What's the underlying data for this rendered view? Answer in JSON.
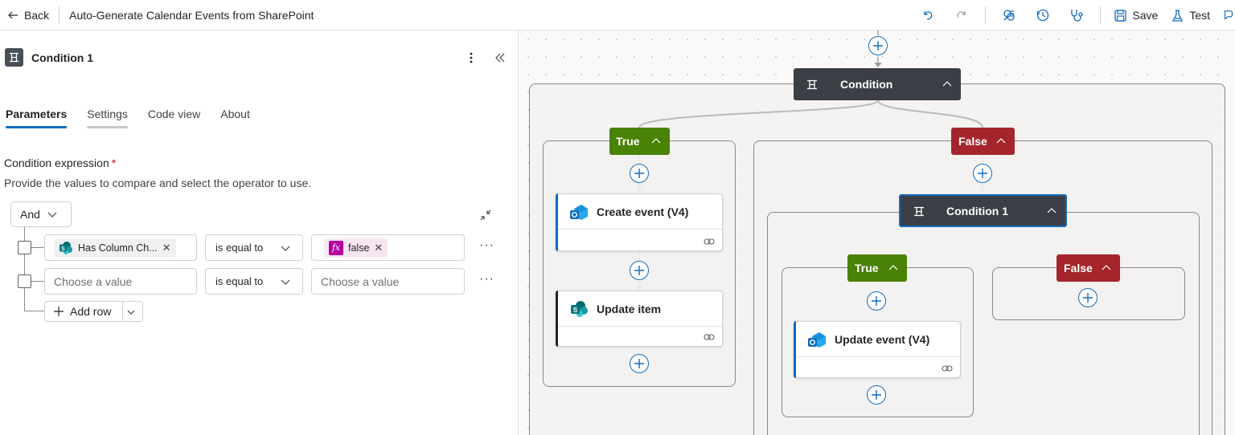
{
  "topbar": {
    "back_label": "Back",
    "title": "Auto-Generate Calendar Events from SharePoint",
    "save_label": "Save",
    "test_label": "Test"
  },
  "panel": {
    "title": "Condition 1",
    "tabs": [
      "Parameters",
      "Settings",
      "Code view",
      "About"
    ],
    "field_label": "Condition expression",
    "required_mark": "*",
    "hint": "Provide the values to compare and select the operator to use.",
    "group_operator": "And",
    "rows": [
      {
        "left_token": "Has Column Ch...",
        "operator": "is equal to",
        "right_token": "false"
      },
      {
        "left_placeholder": "Choose a value",
        "operator": "is equal to",
        "right_placeholder": "Choose a value"
      }
    ],
    "add_row_label": "Add row",
    "more": "···"
  },
  "canvas": {
    "condition": "Condition",
    "true_label": "True",
    "false_label": "False",
    "create_event": "Create event (V4)",
    "update_item": "Update item",
    "condition1": "Condition 1",
    "inner_true": "True",
    "inner_false": "False",
    "update_event": "Update event (V4)"
  },
  "colors": {
    "accent": "#0f6cbd",
    "true": "#498205",
    "false": "#a4262c",
    "condition_header": "#3b3f45",
    "fx": "#b4009e"
  },
  "icons": [
    "back-arrow-icon",
    "undo-icon",
    "redo-icon",
    "flow-checker-icon",
    "history-icon",
    "stethoscope-icon",
    "save-icon",
    "test-flask-icon",
    "condition-icon",
    "kebab-icon",
    "collapse-icon",
    "chevron-down-icon",
    "expand-icon",
    "sharepoint-icon",
    "fx-icon",
    "close-icon",
    "add-icon",
    "outlook-icon",
    "link-icon",
    "chevron-up-icon"
  ]
}
